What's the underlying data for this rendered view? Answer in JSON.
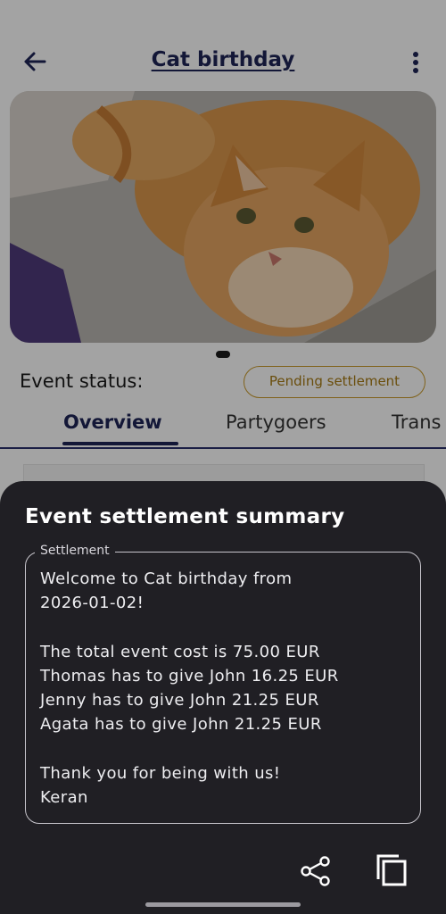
{
  "page": {
    "title": "Cat birthday",
    "status_label": "Event status:",
    "status_badge": "Pending settlement",
    "tabs": [
      "Overview",
      "Partygoers",
      "Trans"
    ]
  },
  "sheet": {
    "title": "Event settlement summary",
    "field_label": "Settlement",
    "settlement_text": "Welcome to Cat birthday from\n2026-01-02!\n\nThe total event cost is 75.00 EUR\nThomas has to give John 16.25 EUR\nJenny has to give John 21.25 EUR\nAgata has to give John 21.25 EUR\n\nThank you for being with us!\nKeran"
  },
  "icons": {
    "back": "arrow-back-icon",
    "menu": "more-vert-icon",
    "share": "share-icon",
    "copy": "copy-icon"
  },
  "colors": {
    "primary": "#1e2457",
    "pending": "#c99a2a",
    "sheet_bg": "#201f24"
  }
}
